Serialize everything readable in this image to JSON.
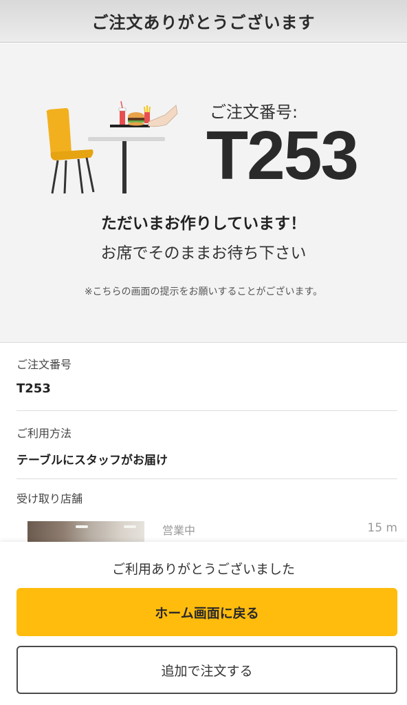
{
  "header": {
    "title": "ご注文ありがとうございます"
  },
  "hero": {
    "order_label": "ご注文番号:",
    "order_number": "T253",
    "status_main": "ただいまお作りしています！",
    "status_sub": "お席でそのままお待ち下さい",
    "notice": "※こちらの画面の提示をお願いすることがございます。"
  },
  "details": {
    "order_number_label": "ご注文番号",
    "order_number_value": "T253",
    "usage_label": "ご利用方法",
    "usage_value": "テーブルにスタッフがお届け",
    "store_label": "受け取り店舗",
    "store_status": "営業中",
    "store_distance": "15 m"
  },
  "footer": {
    "thanks": "ご利用ありがとうございました",
    "home_button": "ホーム画面に戻る",
    "add_order_button": "追加で注文する"
  },
  "colors": {
    "accent": "#ffbc0d",
    "chair": "#f2b01e",
    "background": "#f3f3f3"
  }
}
